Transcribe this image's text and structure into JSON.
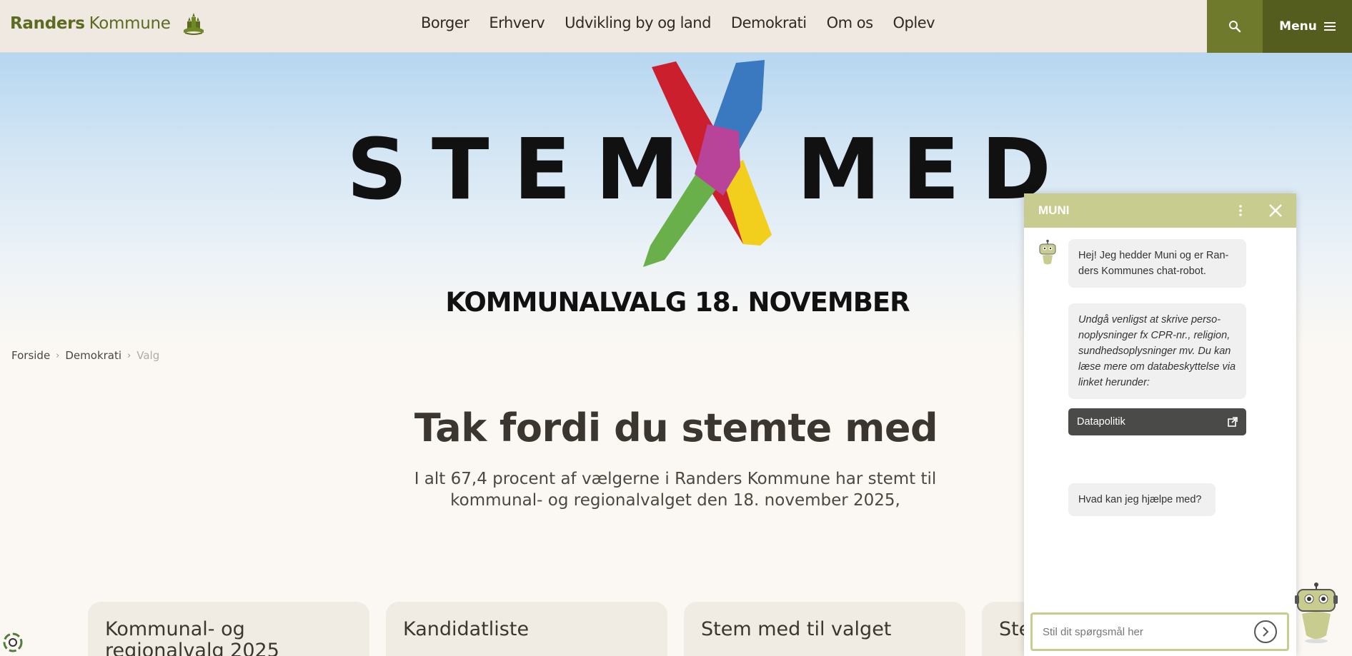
{
  "header": {
    "logo_primary": "Randers",
    "logo_secondary": "Kommune",
    "nav": [
      "Borger",
      "Erhverv",
      "Udvikling by og land",
      "Demokrati",
      "Om os",
      "Oplev"
    ],
    "menu_label": "Menu",
    "search_icon": "search-icon",
    "menu_icon": "hamburger-icon"
  },
  "hero": {
    "word_left": "STEM",
    "word_right": "MED",
    "subtitle": "KOMMUNALVALG 18. NOVEMBER",
    "x_colors": [
      "#cc1f2e",
      "#3a78c0",
      "#6ab04a",
      "#f2cf1d",
      "#b8449a"
    ]
  },
  "breadcrumb": {
    "items": [
      "Forside",
      "Demokrati"
    ],
    "current": "Valg"
  },
  "main": {
    "title": "Tak fordi du stemte med",
    "intro": "I alt 67,4 procent af vælgerne i Randers Kommune har stemt til kommunal- og regionalvalget den 18. november 2025,"
  },
  "cards": [
    {
      "title": "Kommunal- og regionalvalg 2025"
    },
    {
      "title": "Kandidatliste"
    },
    {
      "title": "Stem med til valget"
    },
    {
      "title": "Ste"
    }
  ],
  "chat": {
    "title": "MUNI",
    "messages": [
      "Hej! Jeg hedder Muni og er Ran­ders Kommunes chat-robot.",
      "Undgå venligst at skrive perso­noplysninger fx CPR-nr., religion, sundhedsoplysninger mv. Du kan læse mere om databeskyttelse via linket herunder:"
    ],
    "link_label": "Datapolitik",
    "question": "Hvad kan jeg hjælpe med?",
    "input_placeholder": "Stil dit spørgsmål her"
  },
  "colors": {
    "brand_green": "#5b6b1f",
    "search_bg": "#6f7a2c",
    "menu_bg": "#545d1d",
    "chat_header": "#c8cc8e"
  }
}
